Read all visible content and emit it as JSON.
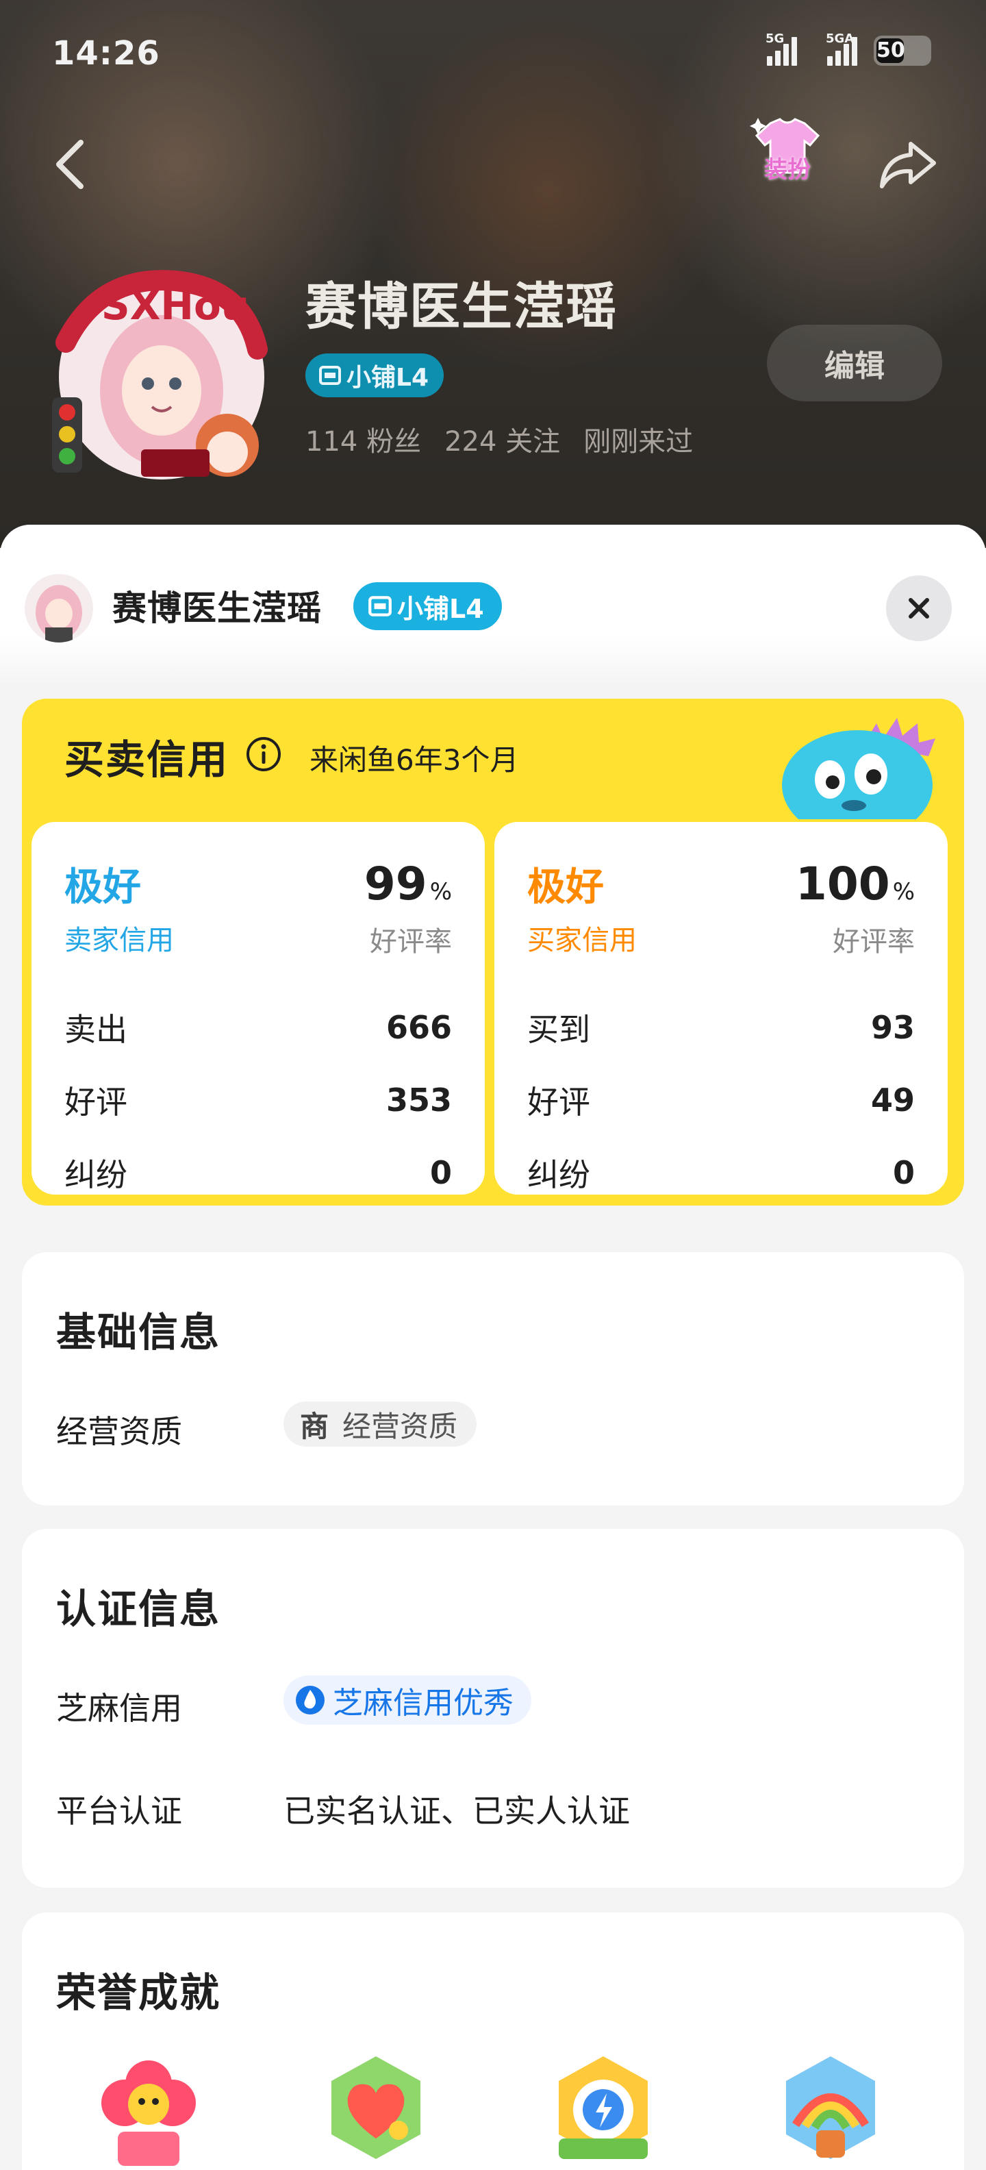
{
  "status_bar": {
    "time": "14:26",
    "signal1_tag": "5G",
    "signal2_tag": "5GA",
    "battery": "50"
  },
  "profile": {
    "name": "赛博医生滢瑶",
    "shop_badge": "小铺L4",
    "fans": "114 粉丝",
    "following": "224 关注",
    "last_seen": "刚刚来过",
    "edit_label": "编辑",
    "dressup_label": "装扮",
    "avatar_text": "SXHou"
  },
  "sheet": {
    "name": "赛博医生滢瑶",
    "shop_badge": "小铺L4"
  },
  "credit": {
    "title": "买卖信用",
    "since": "来闲鱼6年3个月",
    "seller": {
      "grade": "极好",
      "type": "卖家信用",
      "rate": "99",
      "rate_unit": "%",
      "rate_label": "好评率",
      "rows": [
        {
          "label": "卖出",
          "value": "666"
        },
        {
          "label": "好评",
          "value": "353"
        },
        {
          "label": "纠纷",
          "value": "0"
        }
      ]
    },
    "buyer": {
      "grade": "极好",
      "type": "买家信用",
      "rate": "100",
      "rate_unit": "%",
      "rate_label": "好评率",
      "rows": [
        {
          "label": "买到",
          "value": "93"
        },
        {
          "label": "好评",
          "value": "49"
        },
        {
          "label": "纠纷",
          "value": "0"
        }
      ]
    },
    "colors": {
      "seller": "#22a6e6",
      "buyer": "#ff8a00",
      "panel": "#ffe231"
    }
  },
  "basic_info": {
    "title": "基础信息",
    "business_label": "经营资质",
    "business_chip_icon": "商",
    "business_chip_text": "经营资质"
  },
  "cert_info": {
    "title": "认证信息",
    "zhima_label": "芝麻信用",
    "zhima_value": "芝麻信用优秀",
    "platform_label": "平台认证",
    "platform_value": "已实名认证、已实人认证"
  },
  "honors": {
    "title": "荣誉成就",
    "icons": [
      "flower-badge-icon",
      "heart-badge-icon",
      "lightning-badge-icon",
      "rainbow-badge-icon"
    ]
  }
}
